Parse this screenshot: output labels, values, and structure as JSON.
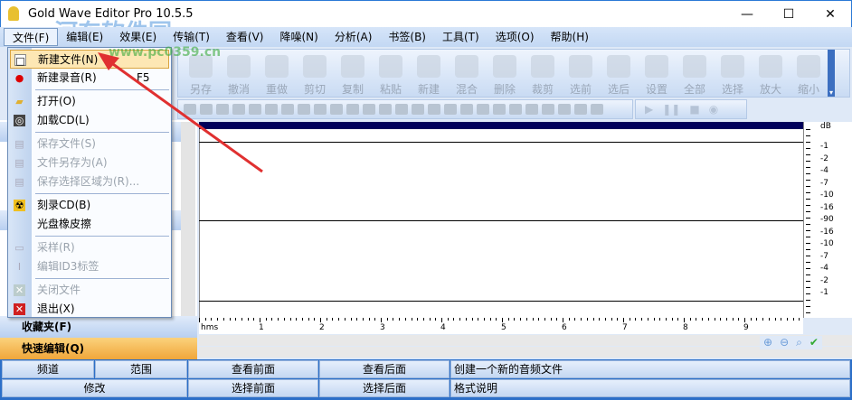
{
  "window": {
    "title": "Gold Wave Editor Pro 10.5.5",
    "minimize": "—",
    "maximize": "☐",
    "close": "✕"
  },
  "watermark": {
    "name": "河东软件园",
    "url": "www.pc0359.cn"
  },
  "menubar": [
    "文件(F)",
    "编辑(E)",
    "效果(E)",
    "传输(T)",
    "查看(V)",
    "降噪(N)",
    "分析(A)",
    "书签(B)",
    "工具(T)",
    "选项(O)",
    "帮助(H)"
  ],
  "toolbar": [
    "另存",
    "撤消",
    "重做",
    "剪切",
    "复制",
    "粘贴",
    "新建",
    "混合",
    "删除",
    "裁剪",
    "选前",
    "选后",
    "设置",
    "全部",
    "选择",
    "放大",
    "缩小"
  ],
  "file_menu": [
    {
      "label": "新建文件(N)",
      "icon": "new-file-icon",
      "state": "hover"
    },
    {
      "label": "新建录音(R)",
      "shortcut": "F5",
      "icon": "record-icon"
    },
    {
      "sep": true
    },
    {
      "label": "打开(O)",
      "icon": "open-folder-icon"
    },
    {
      "label": "加载CD(L)",
      "icon": "cd-icon"
    },
    {
      "sep": true
    },
    {
      "label": "保存文件(S)",
      "icon": "save-icon",
      "disabled": true
    },
    {
      "label": "文件另存为(A)",
      "icon": "save-as-icon",
      "disabled": true
    },
    {
      "label": "保存选择区域为(R)...",
      "icon": "save-selection-icon",
      "disabled": true
    },
    {
      "sep": true
    },
    {
      "label": "刻录CD(B)",
      "icon": "burn-icon"
    },
    {
      "label": "光盘橡皮擦"
    },
    {
      "sep": true
    },
    {
      "label": "采样(R)",
      "icon": "sample-icon",
      "disabled": true
    },
    {
      "label": "编辑ID3标签",
      "icon": "tag-icon",
      "disabled": true
    },
    {
      "sep": true
    },
    {
      "label": "关闭文件",
      "icon": "close-file-icon",
      "disabled": true
    },
    {
      "label": "退出(X)",
      "icon": "exit-icon"
    }
  ],
  "left_panel": {
    "favorites": "收藏夹(F)",
    "quick_edit": "快速编辑(Q)"
  },
  "db_scale": {
    "unit": "dB",
    "labels": [
      "-1",
      "-2",
      "-4",
      "-7",
      "-10",
      "-16",
      "-90",
      "-16",
      "-10",
      "-7",
      "-4",
      "-2",
      "-1"
    ]
  },
  "time_ruler": {
    "unit": "hms",
    "labels": [
      "1",
      "2",
      "3",
      "4",
      "5",
      "6",
      "7",
      "8",
      "9"
    ]
  },
  "status": {
    "row1": [
      "频道",
      "范围",
      "查看前面",
      "查看后面",
      "创建一个新的音频文件"
    ],
    "row2": [
      "修改",
      "选择前面",
      "选择后面",
      "格式说明"
    ]
  },
  "colors": {
    "menu_hover": "#fde7b4",
    "quick_edit": "#f6b448",
    "wave_bg": "#ffffff"
  }
}
